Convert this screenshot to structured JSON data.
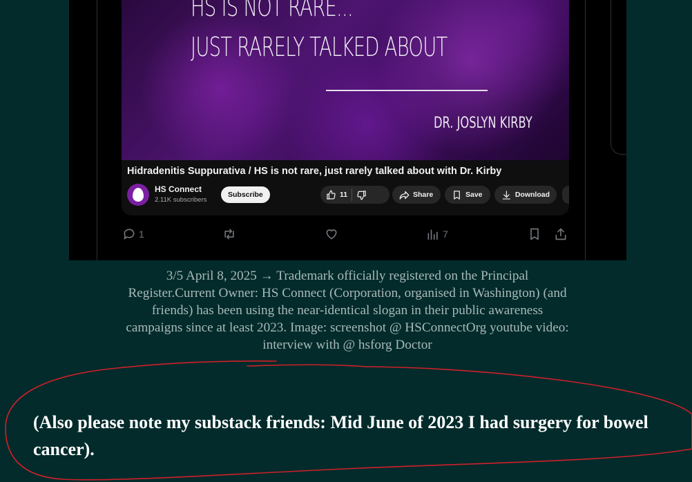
{
  "video": {
    "thumbnail_line1": "HS IS NOT RARE...",
    "thumbnail_line2": "JUST RARELY TALKED ABOUT",
    "thumbnail_author": "DR. JOSLYN KIRBY",
    "title": "Hidradenitis Suppurativa / HS is not rare, just rarely talked about with Dr. Kirby",
    "channel_name": "HS Connect",
    "subscribers": "2.11K subscribers",
    "subscribe_label": "Subscribe",
    "like_count": "11",
    "share_label": "Share",
    "save_label": "Save",
    "download_label": "Download"
  },
  "post_actions": {
    "reply_count": "1",
    "view_count": "7"
  },
  "caption": "3/5 April 8, 2025 → Trademark officially registered on the Principal Register.Current Owner: HS Connect (Corporation, organised in Washington) (and friends) has been using the near-identical slogan in their public awareness campaigns since at least 2023. Image: screenshot @ HSConnectOrg youtube video: interview with @ hsforg Doctor",
  "note": "(Also please note my substack friends: Mid June of 2023 I had surgery for bowel cancer).",
  "colors": {
    "page_background": "#032b2b",
    "marker_red": "#d0202a",
    "avatar_purple": "#7b1fa2"
  }
}
